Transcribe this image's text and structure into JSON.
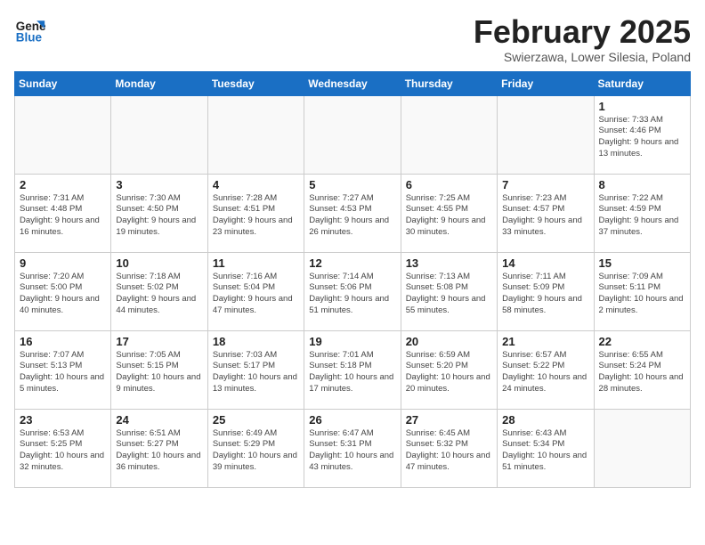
{
  "header": {
    "logo_line1": "General",
    "logo_line2": "Blue",
    "month": "February 2025",
    "location": "Swierzawa, Lower Silesia, Poland"
  },
  "weekdays": [
    "Sunday",
    "Monday",
    "Tuesday",
    "Wednesday",
    "Thursday",
    "Friday",
    "Saturday"
  ],
  "weeks": [
    [
      {
        "day": "",
        "info": ""
      },
      {
        "day": "",
        "info": ""
      },
      {
        "day": "",
        "info": ""
      },
      {
        "day": "",
        "info": ""
      },
      {
        "day": "",
        "info": ""
      },
      {
        "day": "",
        "info": ""
      },
      {
        "day": "1",
        "info": "Sunrise: 7:33 AM\nSunset: 4:46 PM\nDaylight: 9 hours and 13 minutes."
      }
    ],
    [
      {
        "day": "2",
        "info": "Sunrise: 7:31 AM\nSunset: 4:48 PM\nDaylight: 9 hours and 16 minutes."
      },
      {
        "day": "3",
        "info": "Sunrise: 7:30 AM\nSunset: 4:50 PM\nDaylight: 9 hours and 19 minutes."
      },
      {
        "day": "4",
        "info": "Sunrise: 7:28 AM\nSunset: 4:51 PM\nDaylight: 9 hours and 23 minutes."
      },
      {
        "day": "5",
        "info": "Sunrise: 7:27 AM\nSunset: 4:53 PM\nDaylight: 9 hours and 26 minutes."
      },
      {
        "day": "6",
        "info": "Sunrise: 7:25 AM\nSunset: 4:55 PM\nDaylight: 9 hours and 30 minutes."
      },
      {
        "day": "7",
        "info": "Sunrise: 7:23 AM\nSunset: 4:57 PM\nDaylight: 9 hours and 33 minutes."
      },
      {
        "day": "8",
        "info": "Sunrise: 7:22 AM\nSunset: 4:59 PM\nDaylight: 9 hours and 37 minutes."
      }
    ],
    [
      {
        "day": "9",
        "info": "Sunrise: 7:20 AM\nSunset: 5:00 PM\nDaylight: 9 hours and 40 minutes."
      },
      {
        "day": "10",
        "info": "Sunrise: 7:18 AM\nSunset: 5:02 PM\nDaylight: 9 hours and 44 minutes."
      },
      {
        "day": "11",
        "info": "Sunrise: 7:16 AM\nSunset: 5:04 PM\nDaylight: 9 hours and 47 minutes."
      },
      {
        "day": "12",
        "info": "Sunrise: 7:14 AM\nSunset: 5:06 PM\nDaylight: 9 hours and 51 minutes."
      },
      {
        "day": "13",
        "info": "Sunrise: 7:13 AM\nSunset: 5:08 PM\nDaylight: 9 hours and 55 minutes."
      },
      {
        "day": "14",
        "info": "Sunrise: 7:11 AM\nSunset: 5:09 PM\nDaylight: 9 hours and 58 minutes."
      },
      {
        "day": "15",
        "info": "Sunrise: 7:09 AM\nSunset: 5:11 PM\nDaylight: 10 hours and 2 minutes."
      }
    ],
    [
      {
        "day": "16",
        "info": "Sunrise: 7:07 AM\nSunset: 5:13 PM\nDaylight: 10 hours and 5 minutes."
      },
      {
        "day": "17",
        "info": "Sunrise: 7:05 AM\nSunset: 5:15 PM\nDaylight: 10 hours and 9 minutes."
      },
      {
        "day": "18",
        "info": "Sunrise: 7:03 AM\nSunset: 5:17 PM\nDaylight: 10 hours and 13 minutes."
      },
      {
        "day": "19",
        "info": "Sunrise: 7:01 AM\nSunset: 5:18 PM\nDaylight: 10 hours and 17 minutes."
      },
      {
        "day": "20",
        "info": "Sunrise: 6:59 AM\nSunset: 5:20 PM\nDaylight: 10 hours and 20 minutes."
      },
      {
        "day": "21",
        "info": "Sunrise: 6:57 AM\nSunset: 5:22 PM\nDaylight: 10 hours and 24 minutes."
      },
      {
        "day": "22",
        "info": "Sunrise: 6:55 AM\nSunset: 5:24 PM\nDaylight: 10 hours and 28 minutes."
      }
    ],
    [
      {
        "day": "23",
        "info": "Sunrise: 6:53 AM\nSunset: 5:25 PM\nDaylight: 10 hours and 32 minutes."
      },
      {
        "day": "24",
        "info": "Sunrise: 6:51 AM\nSunset: 5:27 PM\nDaylight: 10 hours and 36 minutes."
      },
      {
        "day": "25",
        "info": "Sunrise: 6:49 AM\nSunset: 5:29 PM\nDaylight: 10 hours and 39 minutes."
      },
      {
        "day": "26",
        "info": "Sunrise: 6:47 AM\nSunset: 5:31 PM\nDaylight: 10 hours and 43 minutes."
      },
      {
        "day": "27",
        "info": "Sunrise: 6:45 AM\nSunset: 5:32 PM\nDaylight: 10 hours and 47 minutes."
      },
      {
        "day": "28",
        "info": "Sunrise: 6:43 AM\nSunset: 5:34 PM\nDaylight: 10 hours and 51 minutes."
      },
      {
        "day": "",
        "info": ""
      }
    ]
  ]
}
